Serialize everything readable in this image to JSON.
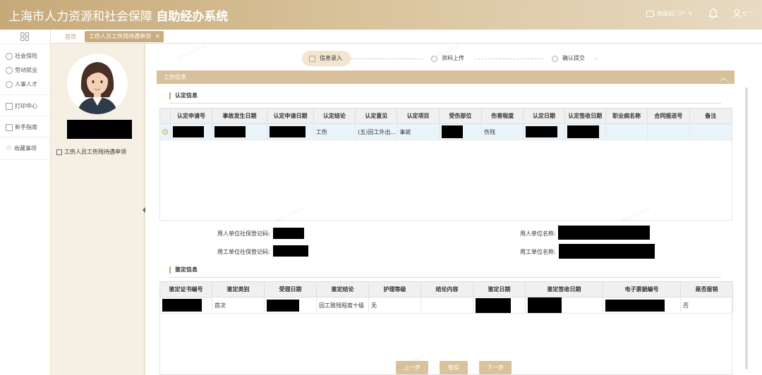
{
  "header": {
    "title_main": "上海市人力资源和社会保障",
    "title_bold": "自助经办系统",
    "portal_label": "改版前门户",
    "user_count": "0"
  },
  "menu": {
    "items": [
      {
        "label": "社会保险",
        "icon": "social-insurance-icon"
      },
      {
        "label": "劳动就业",
        "icon": "employment-icon"
      },
      {
        "label": "人事人才",
        "icon": "talent-icon"
      },
      {
        "label": "打印中心",
        "icon": "printer-icon"
      },
      {
        "label": "新手指南",
        "icon": "guide-icon"
      },
      {
        "label": "收藏事项",
        "icon": "star-icon"
      }
    ]
  },
  "tabs": {
    "home": "首页",
    "active": "工伤人员工伤残待遇申领",
    "close": "×"
  },
  "profile": {
    "link_label": "工伤人员工伤残待遇申领"
  },
  "steps": [
    {
      "label": "信息录入",
      "state": "active"
    },
    {
      "label": "资料上传",
      "state": "idle"
    },
    {
      "label": "确认提交",
      "state": "idle"
    }
  ],
  "section": {
    "title": "工伤信息",
    "collapse": "︿"
  },
  "identification": {
    "title": "认定信息",
    "columns": [
      "认定申请号",
      "事故发生日期",
      "认定申请日期",
      "认定结论",
      "认定意见",
      "认定项目",
      "受伤部位",
      "伤害程度",
      "认定日期",
      "认定签收日期",
      "职业病名称",
      "合同报送号",
      "备注"
    ],
    "row": {
      "conclusion": "工伤",
      "opinion": "(五)因工外出...",
      "item": "事故",
      "injury_degree": "伤残"
    }
  },
  "form": {
    "employer_code_label": "用人单位社保登记码:",
    "employer_name_label": "用人单位名称:",
    "user_code_label": "用工单位社保登记码:",
    "user_name_label": "用工单位名称:"
  },
  "appraisal": {
    "title": "鉴定信息",
    "columns": [
      "鉴定证书编号",
      "鉴定类别",
      "受理日期",
      "鉴定结论",
      "护理等级",
      "结论内容",
      "鉴定日期",
      "鉴定签收日期",
      "电子票据编号",
      "是否报销"
    ],
    "row": {
      "category": "首次",
      "conclusion": "因工致残程度十级",
      "nursing": "无",
      "reimbursed": "否"
    }
  },
  "buttons": {
    "prev": "上一步",
    "save": "暂存",
    "next": "下一步"
  }
}
